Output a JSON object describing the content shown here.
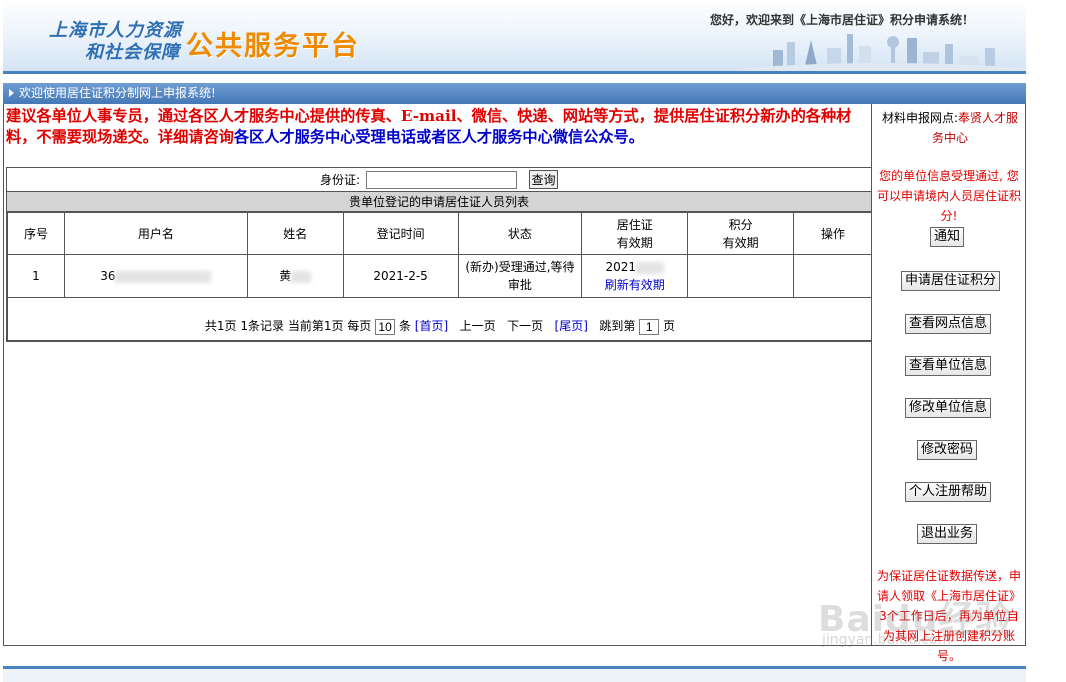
{
  "header": {
    "logo_line1": "上海市人力资源",
    "logo_line2": "和社会保障",
    "platform": "公共服务平台",
    "welcome": "您好，欢迎来到《上海市居住证》积分申请系统！"
  },
  "welcome_bar": "欢迎使用居住证积分制网上申报系统!",
  "notice": {
    "red": "建议各单位人事专员，通过各区人才服务中心提供的传真、E-mail、微信、快递、网站等方式，提供居住证积分新办的各种材料，不需要现场递交。详细请咨询",
    "blue": "各区人才服务中心受理电话或者区人才服务中心微信公众号。"
  },
  "search": {
    "label": "身份证:",
    "value": "",
    "button": "查询"
  },
  "list_title": "贵单位登记的申请居住证人员列表",
  "table": {
    "headers": [
      [
        "序号"
      ],
      [
        "用户名"
      ],
      [
        "姓名"
      ],
      [
        "登记时间"
      ],
      [
        "状态"
      ],
      [
        "居住证",
        "有效期"
      ],
      [
        "积分",
        "有效期"
      ],
      [
        "操作"
      ]
    ],
    "rows": [
      {
        "index": "1",
        "username": "36",
        "name": "黄",
        "registered": "2021-2-5",
        "status_line1": "(新办)受理通过,等待",
        "status_line2": "审批",
        "permit_valid": "2021",
        "refresh": "刷新有效期",
        "points_valid": "",
        "action": ""
      }
    ]
  },
  "pager": {
    "summary": "共1页 1条记录 当前第1页 每页",
    "page_size": "10",
    "unit": "条",
    "first": "[首页]",
    "prev": "上一页",
    "next": "下一页",
    "last": "[尾页]",
    "jump": "跳到第",
    "jump_value": "1",
    "page_suffix": "页"
  },
  "sidebar": {
    "point_label": "材料申报网点:",
    "point_value": "奉贤人才服务中心",
    "message": "您的单位信息受理通过, 您可以申请境内人员居住证积分!",
    "buttons": [
      "通知",
      "申请居住证积分",
      "查看网点信息",
      "查看单位信息",
      "修改单位信息",
      "修改密码",
      "个人注册帮助",
      "退出业务"
    ],
    "footer": "为保证居住证数据传送，申请人领取《上海市居住证》3个工作日后，再为单位自为其网上注册创建积分账号。"
  },
  "watermark": "Baidu经验",
  "watermark_sub": "jingyan.baidu.com",
  "colors": {
    "accent_blue": "#4a82c0",
    "notice_red": "#e00000",
    "link_blue": "#0000cc",
    "platform_orange": "#f08a00"
  }
}
